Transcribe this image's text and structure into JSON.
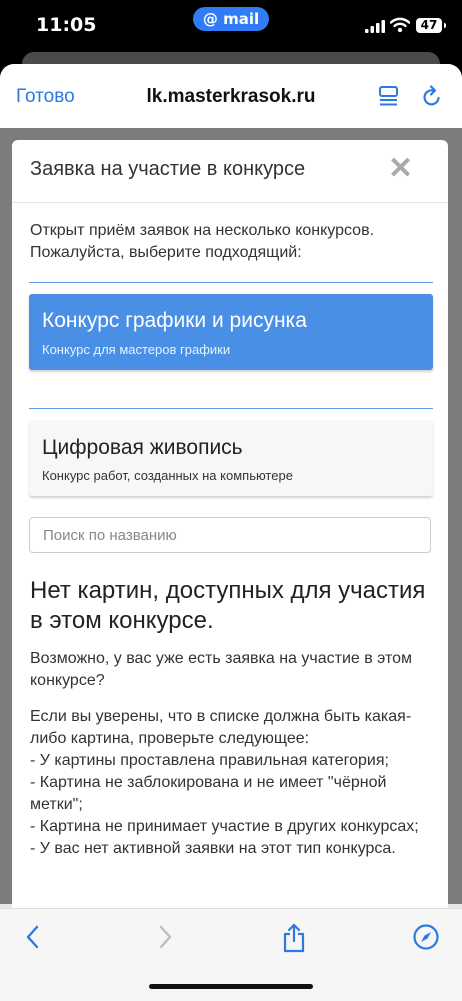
{
  "status_bar": {
    "time": "11:05",
    "pill_label": "@ mail",
    "battery": "47"
  },
  "browser": {
    "done_label": "Готово",
    "url": "lk.masterkrasok.ru"
  },
  "modal": {
    "title": "Заявка на участие в конкурсе",
    "close_symbol": "✕",
    "intro": "Открыт приём заявок на несколько конкурсов. Пожалуйста, выберите подходящий:",
    "options": [
      {
        "title": "Конкурс графики и рисунка",
        "subtitle": "Конкурс для мастеров графики",
        "selected": true
      },
      {
        "title": "Цифровая живопись",
        "subtitle": "Конкурс работ, созданных на компьютере",
        "selected": false
      }
    ],
    "search_placeholder": "Поиск по названию",
    "empty_heading": "Нет картин, доступных для участия в этом конкурсе.",
    "empty_text_1": "Возможно, у вас уже есть заявка на участие в этом конкурсе?",
    "empty_text_2": "Если вы уверены, что в списке должна быть какая-либо картина, проверьте следующее:\n- У картины проставлена правильная категория;\n- Картина не заблокирована и не имеет \"чёрной метки\";\n- Картина не принимает участие в других конкурсах;\n- У вас нет активной заявки на этот тип конкурса."
  },
  "colors": {
    "accent": "#2a7ae2",
    "selected_option": "#4a8fe6",
    "divider": "#5b9ae0"
  },
  "toolbar_icons": [
    "back-icon",
    "forward-icon",
    "share-icon",
    "compass-icon"
  ]
}
